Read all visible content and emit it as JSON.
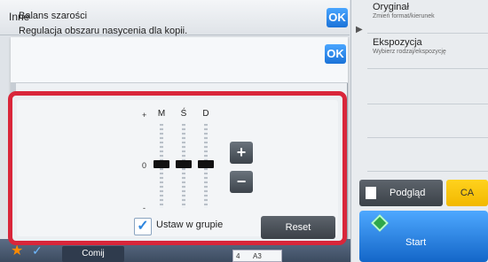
{
  "header": {
    "title": "Inne",
    "ok_label": "OK"
  },
  "side_panel": {
    "items": [
      {
        "title": "Oryginał",
        "subtitle": "Zmień format/kierunek"
      },
      {
        "title": "Ekspozycja",
        "subtitle": "Wybierz rodzaj/ekspozycję"
      }
    ],
    "preview_label": "Podgląd",
    "ca_label": "CA",
    "start_label": "Start"
  },
  "bottom_bar": {
    "copies_label": "Comij",
    "paper_tray": "4",
    "paper_size": "A3"
  },
  "dialog": {
    "title": "Balans szarości",
    "subtitle": "Regulacja obszaru nasycenia dla kopii.",
    "ok_label": "OK",
    "scale": {
      "top": "+",
      "middle": "0",
      "bottom": "-"
    },
    "columns": [
      {
        "label": "M",
        "level": 0
      },
      {
        "label": "Ś",
        "level": 0
      },
      {
        "label": "D",
        "level": 0
      }
    ],
    "plus_label": "+",
    "minus_label": "−",
    "group_checkbox": {
      "label": "Ustaw w grupie",
      "checked": true
    },
    "reset_label": "Reset"
  },
  "colors": {
    "accent": "#1a72d8",
    "highlight_frame": "#d9263a",
    "ca": "#f2b800"
  }
}
